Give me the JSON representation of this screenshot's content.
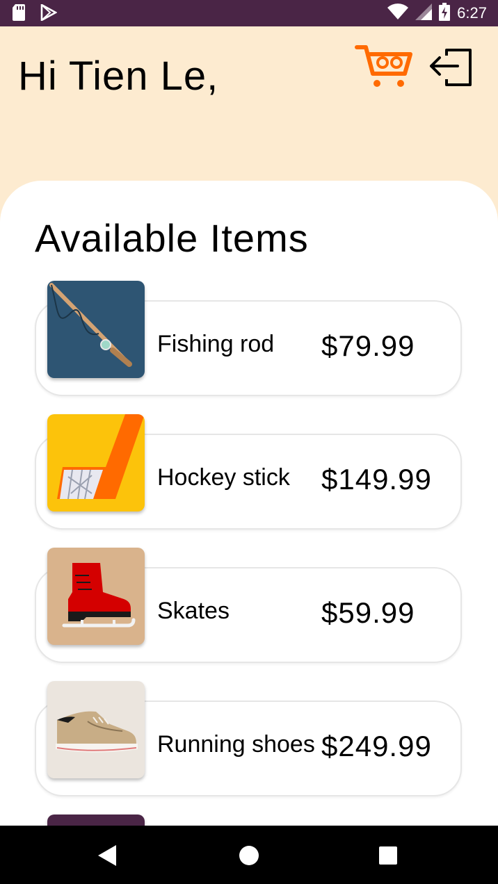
{
  "status_bar": {
    "time": "6:27",
    "icons": [
      "sd-card-icon",
      "play-store-icon",
      "wifi-icon",
      "signal-icon",
      "battery-icon"
    ]
  },
  "header": {
    "greeting": "Hi Tien Le,",
    "cart_icon": "cart-icon",
    "logout_icon": "logout-icon"
  },
  "panel": {
    "title": "Available Items"
  },
  "items": [
    {
      "name": "Fishing rod",
      "price": "$79.99",
      "thumb_bg": "#2e5573",
      "icon": "fishing-rod-icon"
    },
    {
      "name": "Hockey stick",
      "price": "$149.99",
      "thumb_bg": "#fcc30b",
      "icon": "hockey-stick-icon"
    },
    {
      "name": "Skates",
      "price": "$59.99",
      "thumb_bg": "#d9b38c",
      "icon": "skate-icon"
    },
    {
      "name": "Running shoes",
      "price": "$249.99",
      "thumb_bg": "#ebe5de",
      "icon": "shoe-icon"
    }
  ],
  "nav": {
    "back_icon": "back-icon",
    "home_icon": "home-icon",
    "recents_icon": "recents-icon"
  },
  "colors": {
    "status_bar": "#4a2546",
    "header_bg": "#fdebd0",
    "cart_accent": "#ff6a00"
  }
}
